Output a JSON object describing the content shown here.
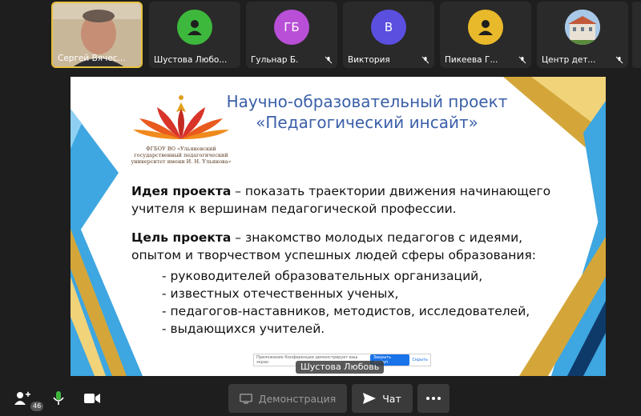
{
  "participants": [
    {
      "name": "Сергей Вячес...",
      "type": "video",
      "active": true
    },
    {
      "name": "Шустова Любо...",
      "type": "avatar",
      "initials": "",
      "color": "#3db83d"
    },
    {
      "name": "Гульнар Б.",
      "type": "avatar",
      "initials": "ГБ",
      "color": "#b84fd6",
      "muted": true
    },
    {
      "name": "Виктория",
      "type": "avatar",
      "initials": "В",
      "color": "#5b4fe0",
      "muted": true
    },
    {
      "name": "Пикеева Г...",
      "type": "avatar",
      "initials": "",
      "color": "#e8b92a",
      "muted": true
    },
    {
      "name": "Центр дет...",
      "type": "photo",
      "muted": true
    }
  ],
  "slide": {
    "title_line1": "Научно-образовательный проект",
    "title_line2": "«Педагогический инсайт»",
    "logo_caption_line1": "ФГБОУ ВО «Ульяновский",
    "logo_caption_line2": "государственный педагогический",
    "logo_caption_line3": "университет имени И. Н. Ульянова»",
    "idea_label": "Идея проекта",
    "idea_text": " – показать траектории движения начинающего учителя к вершинам педагогической профессии.",
    "goal_label": "Цель проекта",
    "goal_text": " – знакомство молодых педагогов с идеями, опытом и творчеством успешных людей сферы образования:",
    "bullets": [
      "руководителей образовательных организаций,",
      "известных отечественных ученых,",
      "педагогов-наставников, методистов, исследователей,",
      "выдающихся учителей."
    ],
    "popup_text": "Приложение Конференции демонстрирует ваш экран",
    "popup_button": "Закрыть доступ",
    "popup_link": "Скрыть"
  },
  "speaker_label": "Шустова Любовь",
  "toolbar": {
    "participants_count": "46",
    "demo_label": "Демонстрация",
    "chat_label": "Чат"
  },
  "colors": {
    "accent_gold": "#e8c23b",
    "slide_title": "#3a5fa8",
    "slide_blue": "#3ea6e0"
  }
}
